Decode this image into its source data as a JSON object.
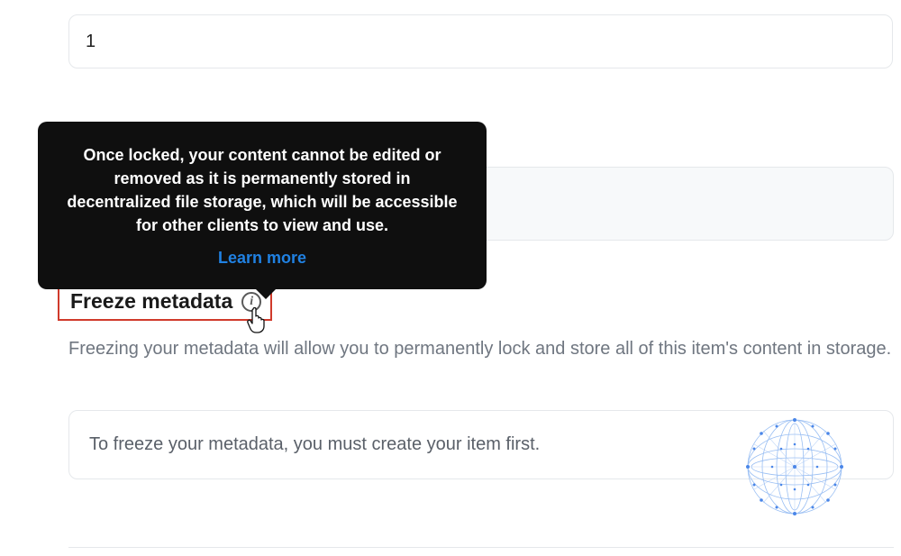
{
  "supply": {
    "value": "1"
  },
  "tooltip": {
    "body": "Once locked, your content cannot be edited or removed as it is permanently stored in decentralized file storage, which will be accessible for other clients to view and use.",
    "learn_more": "Learn more"
  },
  "freeze": {
    "title": "Freeze metadata",
    "description": "Freezing your metadata will allow you to permanently lock and store all of this item's content in storage.",
    "notice": "To freeze your metadata, you must create your item first."
  }
}
